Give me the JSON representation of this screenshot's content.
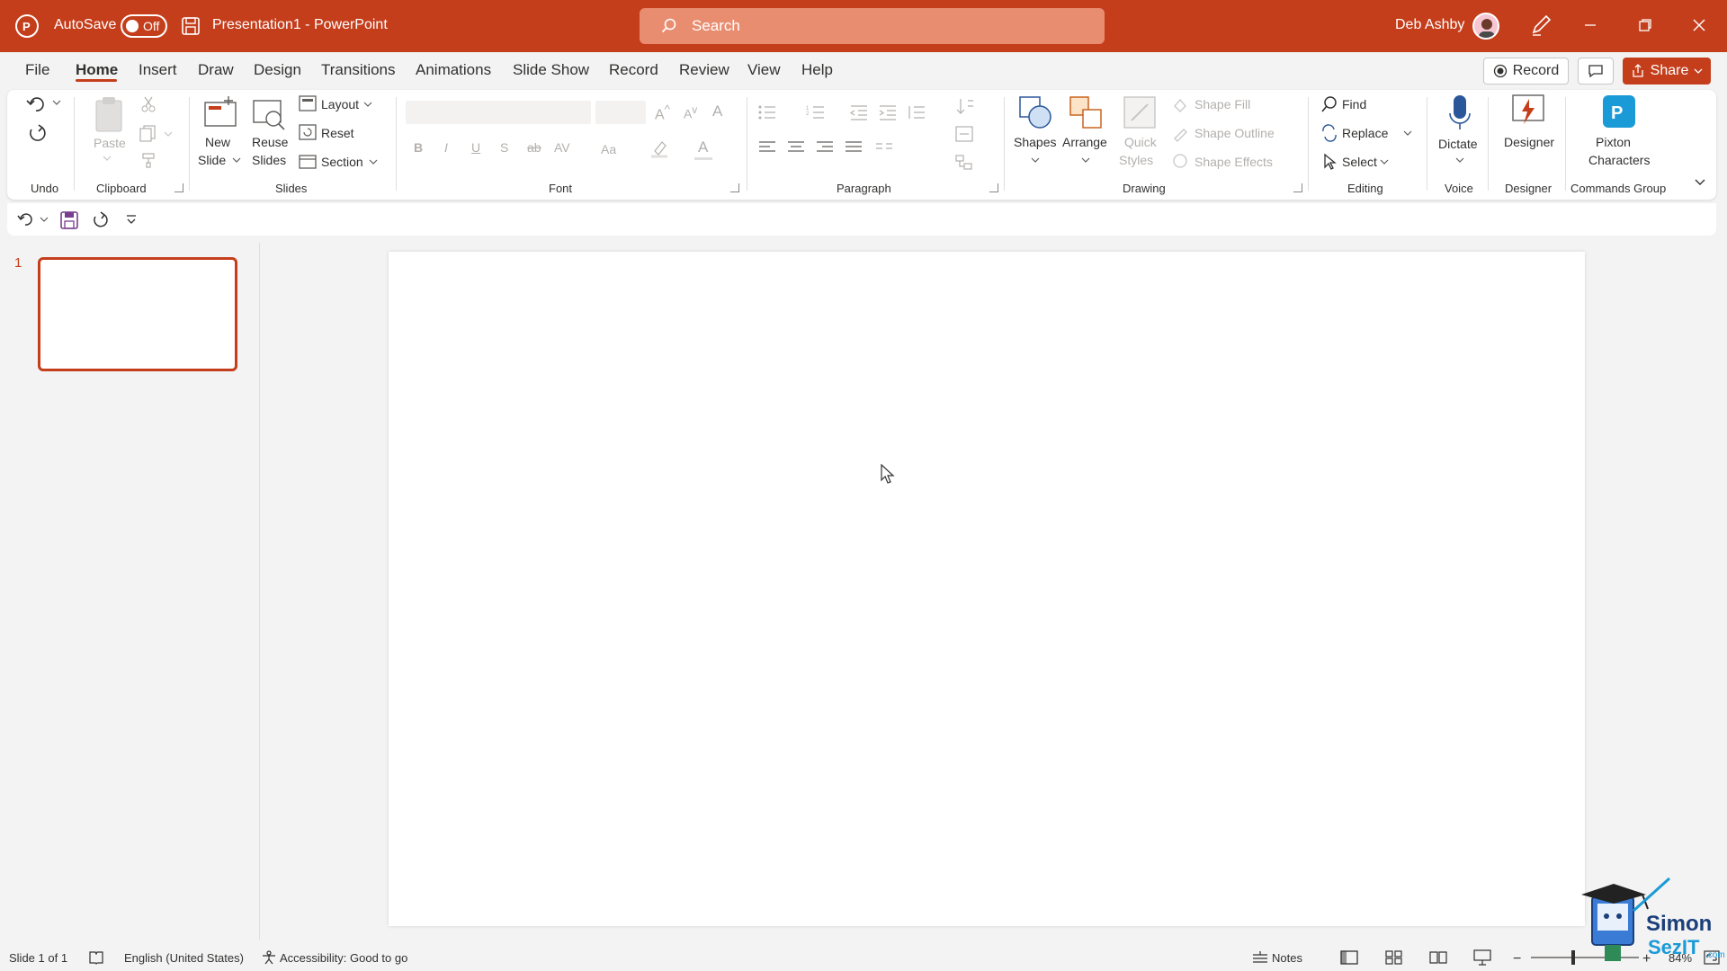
{
  "titlebar": {
    "autosave_label": "AutoSave",
    "autosave_state": "Off",
    "filename": "Presentation1  -  PowerPoint",
    "search_placeholder": "Search",
    "user_name": "Deb Ashby",
    "brand_color": "#c43e1c"
  },
  "tabs": [
    "File",
    "Home",
    "Insert",
    "Draw",
    "Design",
    "Transitions",
    "Animations",
    "Slide Show",
    "Record",
    "Review",
    "View",
    "Help"
  ],
  "active_tab": "Home",
  "header_buttons": {
    "record": "Record",
    "share": "Share"
  },
  "ribbon": {
    "groups": {
      "undo": "Undo",
      "clipboard": "Clipboard",
      "slides": "Slides",
      "font": "Font",
      "paragraph": "Paragraph",
      "drawing": "Drawing",
      "editing": "Editing",
      "voice": "Voice",
      "designer": "Designer",
      "commands": "Commands Group"
    },
    "clipboard": {
      "paste": "Paste"
    },
    "slides": {
      "new_slide_1": "New",
      "new_slide_2": "Slide",
      "reuse_1": "Reuse",
      "reuse_2": "Slides",
      "layout": "Layout",
      "reset": "Reset",
      "section": "Section"
    },
    "drawing": {
      "shapes": "Shapes",
      "arrange": "Arrange",
      "quick_1": "Quick",
      "quick_2": "Styles",
      "shape_fill": "Shape Fill",
      "shape_outline": "Shape Outline",
      "shape_effects": "Shape Effects"
    },
    "editing": {
      "find": "Find",
      "replace": "Replace",
      "select": "Select"
    },
    "voice": {
      "dictate": "Dictate"
    },
    "designer": {
      "designer": "Designer"
    },
    "commands": {
      "pixton_1": "Pixton",
      "pixton_2": "Characters"
    }
  },
  "slide_pane": {
    "slide_number": "1"
  },
  "status": {
    "slide_info": "Slide 1 of 1",
    "language": "English (United States)",
    "accessibility": "Accessibility: Good to go",
    "notes": "Notes",
    "zoom": "84%"
  },
  "watermark": {
    "line1": "Simon",
    "line2": "SezIT",
    "suffix": ".com"
  }
}
